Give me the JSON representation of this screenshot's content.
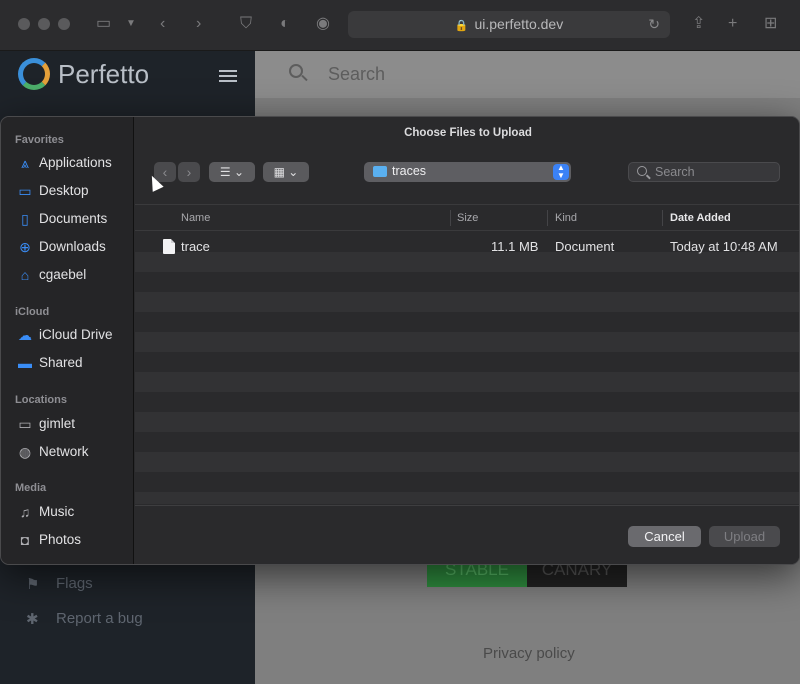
{
  "browser": {
    "url": "ui.perfetto.dev"
  },
  "perfetto": {
    "brand": "Perfetto",
    "search_placeholder": "Search",
    "sidebar_links": [
      "Flags",
      "Report a bug"
    ],
    "channels": [
      "STABLE",
      "CANARY"
    ],
    "privacy_link": "Privacy policy"
  },
  "dialog": {
    "title": "Choose Files to Upload",
    "sidebar": {
      "favorites_title": "Favorites",
      "favorites": [
        {
          "label": "Applications",
          "icon": "applications-icon"
        },
        {
          "label": "Desktop",
          "icon": "desktop-icon"
        },
        {
          "label": "Documents",
          "icon": "documents-icon"
        },
        {
          "label": "Downloads",
          "icon": "downloads-icon"
        },
        {
          "label": "cgaebel",
          "icon": "home-icon"
        }
      ],
      "icloud_title": "iCloud",
      "icloud": [
        {
          "label": "iCloud Drive",
          "icon": "cloud-icon"
        },
        {
          "label": "Shared",
          "icon": "shared-folder-icon"
        }
      ],
      "locations_title": "Locations",
      "locations": [
        {
          "label": "gimlet",
          "icon": "laptop-icon"
        },
        {
          "label": "Network",
          "icon": "network-globe-icon"
        }
      ],
      "media_title": "Media",
      "media": [
        {
          "label": "Music",
          "icon": "music-note-icon"
        },
        {
          "label": "Photos",
          "icon": "camera-icon"
        }
      ]
    },
    "current_folder": "traces",
    "search_placeholder": "Search",
    "columns": {
      "name": "Name",
      "size": "Size",
      "kind": "Kind",
      "date_added": "Date Added"
    },
    "files": [
      {
        "name": "trace",
        "size": "11.1 MB",
        "kind": "Document",
        "date_added": "Today at 10:48 AM"
      }
    ],
    "buttons": {
      "cancel": "Cancel",
      "upload": "Upload"
    }
  },
  "colors": {
    "accent": "#3b82f6",
    "dialog_bg": "#2a2a2c",
    "stable_channel": "#2e8b3e"
  }
}
